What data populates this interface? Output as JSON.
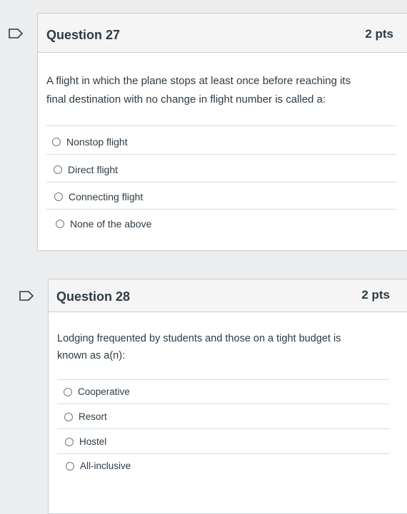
{
  "questions": [
    {
      "title": "Question 27",
      "points": "2 pts",
      "text_line1": "A flight in which the plane stops at least once before reaching its",
      "text_line2": "final destination with no change in flight number is called a:",
      "answers": [
        "Nonstop flight",
        "Direct flight",
        "Connecting flight",
        "None of the above"
      ]
    },
    {
      "title": "Question 28",
      "points": "2 pts",
      "text_line1": "Lodging frequented by students and those on a tight budget is",
      "text_line2": "known as a(n):",
      "answers": [
        "Cooperative",
        "Resort",
        "Hostel",
        "All-inclusive"
      ]
    }
  ],
  "colors": {
    "page_bg": "#ecedef",
    "card_bg": "#ffffff",
    "header_bg": "#f5f5f5",
    "border": "#c7cdd1",
    "text": "#2d3b45",
    "flag_stroke": "#2d3b45"
  },
  "icons": {
    "flag": "flag-bookmark-icon",
    "radio": "radio-button-icon"
  }
}
